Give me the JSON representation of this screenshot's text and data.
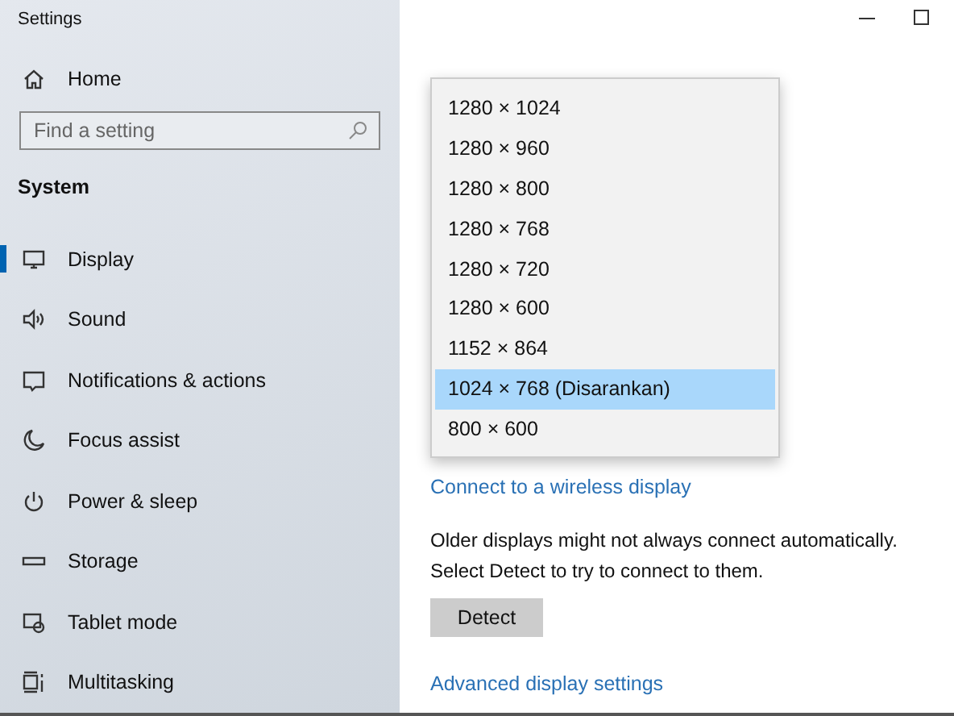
{
  "window": {
    "title": "Settings"
  },
  "sidebar": {
    "home": "Home",
    "search": {
      "placeholder": "Find a setting"
    },
    "section": "System",
    "items": [
      {
        "label": "Display",
        "selected": true
      },
      {
        "label": "Sound",
        "selected": false
      },
      {
        "label": "Notifications & actions",
        "selected": false
      },
      {
        "label": "Focus assist",
        "selected": false
      },
      {
        "label": "Power & sleep",
        "selected": false
      },
      {
        "label": "Storage",
        "selected": false
      },
      {
        "label": "Tablet mode",
        "selected": false
      },
      {
        "label": "Multitasking",
        "selected": false
      }
    ]
  },
  "resolution_dropdown": {
    "options": [
      {
        "label": "1280 × 1024",
        "selected": false
      },
      {
        "label": "1280 × 960",
        "selected": false
      },
      {
        "label": "1280 × 800",
        "selected": false
      },
      {
        "label": "1280 × 768",
        "selected": false
      },
      {
        "label": "1280 × 720",
        "selected": false
      },
      {
        "label": "1280 × 600",
        "selected": false
      },
      {
        "label": "1152 × 864",
        "selected": false
      },
      {
        "label": "1024 × 768 (Disarankan)",
        "selected": true
      },
      {
        "label": "800 × 600",
        "selected": false
      }
    ]
  },
  "wireless_link": "Connect to a wireless display",
  "detect_text": "Older displays might not always connect automatically. Select Detect to try to connect to them.",
  "detect_button": "Detect",
  "advanced_link": "Advanced display settings"
}
